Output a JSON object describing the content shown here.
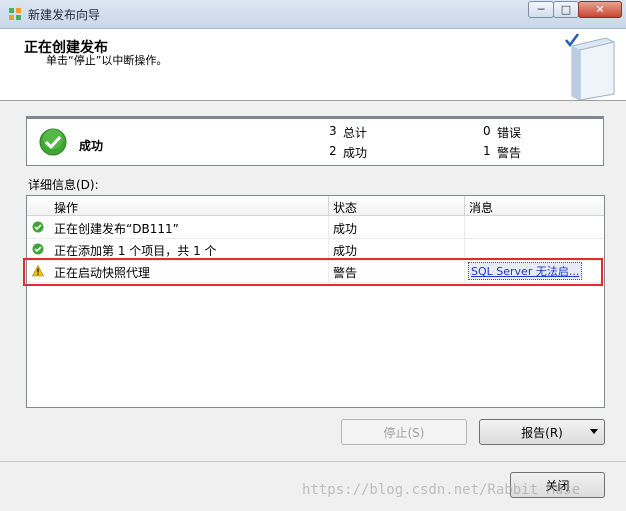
{
  "window": {
    "title": "新建发布向导",
    "minimize_glyph": "─",
    "maximize_glyph": "□",
    "close_glyph": "✕"
  },
  "header": {
    "title": "正在创建发布",
    "subtitle": "单击“停止”以中断操作。",
    "icon": "book-check-icon"
  },
  "summary": {
    "status": "成功",
    "status_icon": "check-circle-icon",
    "total_count": "3",
    "total_label": "总计",
    "success_count": "2",
    "success_label": "成功",
    "error_count": "0",
    "error_label": "错误",
    "warning_count": "1",
    "warning_label": "警告"
  },
  "details_label": "详细信息(D):",
  "grid": {
    "columns": [
      "操作",
      "状态",
      "消息"
    ],
    "rows": [
      {
        "icon": "success-icon",
        "action": "正在创建发布“DB111”",
        "status": "成功",
        "message": ""
      },
      {
        "icon": "success-icon",
        "action": "正在添加第 1 个项目，共 1 个",
        "status": "成功",
        "message": ""
      },
      {
        "icon": "warning-icon",
        "action": "正在启动快照代理",
        "status": "警告",
        "message": "SQL Server 无法启..."
      }
    ]
  },
  "buttons": {
    "stop": "停止(S)",
    "report": "报告(R)",
    "close": "关闭"
  },
  "watermark": "https://blog.csdn.net/Rabbit Muse",
  "colors": {
    "highlight_border": "#e02c2c",
    "link": "#1b36c9"
  }
}
